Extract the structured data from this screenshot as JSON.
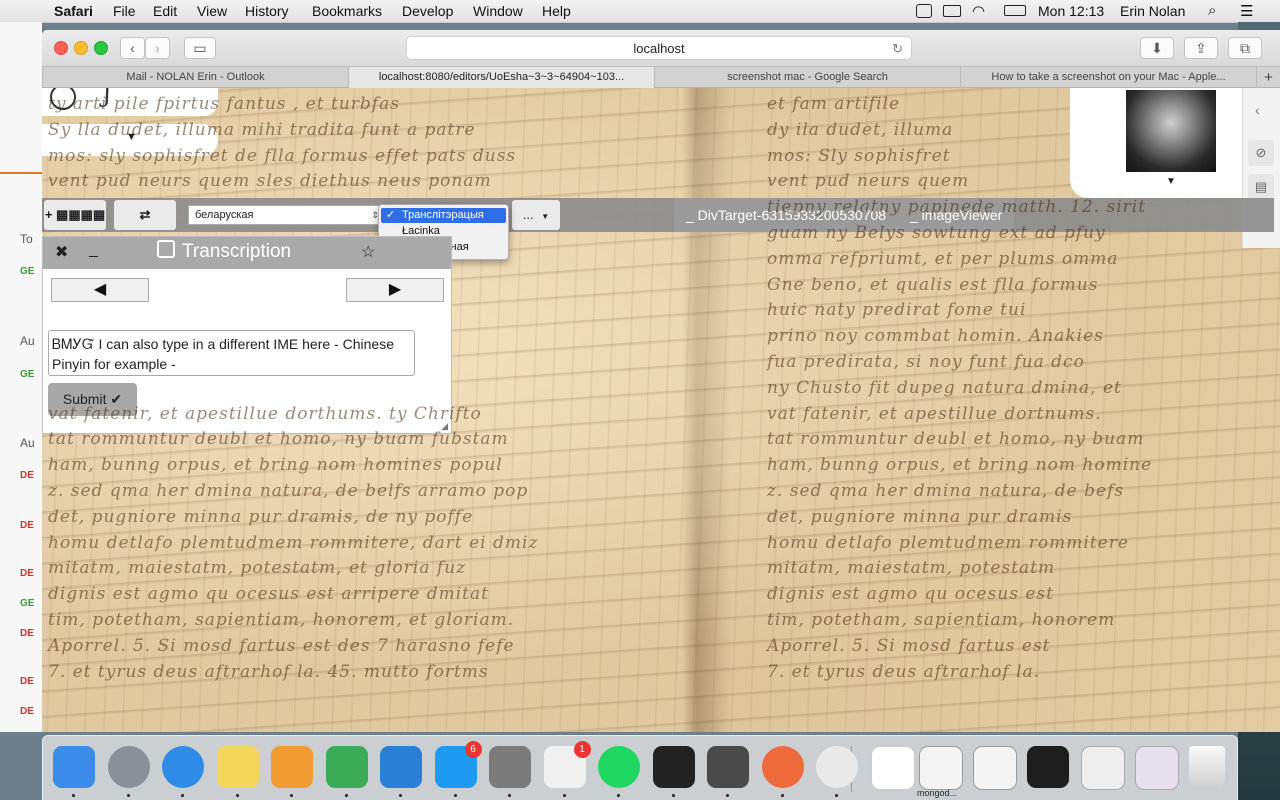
{
  "menubar": {
    "apple": "",
    "app": "Safari",
    "items": [
      "File",
      "Edit",
      "View",
      "History",
      "Bookmarks",
      "Develop",
      "Window",
      "Help"
    ],
    "clock": "Mon 12:13",
    "user": "Erin Nolan"
  },
  "background_window": {
    "labels": [
      "To",
      "GE",
      "Au",
      "GE",
      "Au",
      "DE",
      "DE",
      "DE",
      "GE",
      "DE",
      "DE",
      "DE"
    ]
  },
  "browser": {
    "url": "localhost",
    "tabs": [
      "Mail - NOLAN Erin - Outlook",
      "localhost:8080/editors/UoEsha~3~3~64904~103...",
      "screenshot mac - Google Search",
      "How to take a screenshot on your Mac - Apple..."
    ],
    "new_tab": "+"
  },
  "toolbar": {
    "add_button": "+ ▦▦▦▦",
    "switch_button": "⇄ ▦▦▦▦",
    "language_value": "беларуская",
    "more_button": "...",
    "script_options": [
      {
        "label": "Транслітэрацыя",
        "selected": true
      },
      {
        "label": "Łacinka",
        "selected": false
      },
      {
        "label": "Стандартная",
        "selected": false
      }
    ],
    "view_tabs": [
      "_ DivTarget-6315933200530708",
      "_ imageViewer"
    ]
  },
  "transcription": {
    "close": "✖",
    "minimize": "_",
    "title": "Transcription",
    "star": "☆",
    "prev": "◀",
    "next": "▶",
    "text": "ᏴᎷᎩᏳ I can also type in a different IME here - Chinese Pinyin for example -",
    "submit_label": "Submit ✔"
  },
  "manuscript_lines_left": [
    "ty arti pile fpirtus fantus , et turbfas",
    "Sy lla dudet, illuma mihi tradita funt a patre",
    "mos: sly sophisfret de flla formus effet pats duss",
    "vent pud neurs quem sles diethus neus ponam",
    "",
    "",
    "",
    "",
    "",
    "",
    "",
    "",
    "vat fatenir, et apestillue dorthums. ty Chrifto",
    "tat rommuntur deubl et homo, ny buam fubstam",
    "ham, bunng orpus, et bring nom homines popul",
    "z. sed qma her dmina natura, de belfs arramo pop",
    "det, pugniore minna pur dramis, de ny poffe",
    "homu detlafo plemtudmem rommitere, dart ei dmiz",
    "mitatm, maiestatm, potestatm, et gloria fuz",
    "dignis est agmo qu ocesus est arripere dmitat",
    "tim, potetham, sapientiam, honorem, et gloriam.",
    "Aporrel. 5. Si mosd fartus est des 7 harasno fefe",
    "7. et tyrus deus aftrarhof la. 45. mutto fortms"
  ],
  "manuscript_lines_right": [
    "et fam artifile",
    "dy ila dudet, illuma",
    "mos: Sly sophisfret",
    "vent pud neurs quem",
    "tiepny relatny papinede matth. 12. sirit",
    "guam ny Belys sowtung ext ad pfuy",
    "omma refpriumt, et per plums omma",
    "Gne beno, et qualis est flla formus",
    "huic naty predirat fome tui",
    "prino noy commbat homin. Anakies",
    "fua predirata, si noy funt fua dco",
    "ny Chusto fit dupeg natura dmina, et",
    "vat fatenir, et apestillue dortnums.",
    "tat rommuntur deubl et homo, ny buam",
    "ham, bunng orpus, et bring nom homine",
    "z. sed qma her dmina natura, de befs",
    "det, pugniore minna pur dramis",
    "homu detlafo plemtudmem rommitere",
    "mitatm, maiestatm, potestatm",
    "dignis est agmo qu ocesus est",
    "tim, potetham, sapientiam, honorem",
    "Aporrel. 5. Si mosd fartus est",
    "7. et tyrus deus aftrarhof la."
  ],
  "dock": {
    "apps": [
      "Finder",
      "Launchpad",
      "Safari",
      "Notes",
      "Pages",
      "Numbers",
      "Keynote",
      "App Store",
      "System Preferences",
      "Slack",
      "Spotify",
      "Terminal",
      "Sublime Text",
      "Postman",
      "Chrome"
    ],
    "badges": {
      "App Store": "6",
      "Slack": "1"
    },
    "recent_label": "mongod..."
  },
  "colors": {
    "accent_blue": "#2f6fe5",
    "panel_header": "#a9a9a9",
    "parchment": "#e6cfa6"
  }
}
